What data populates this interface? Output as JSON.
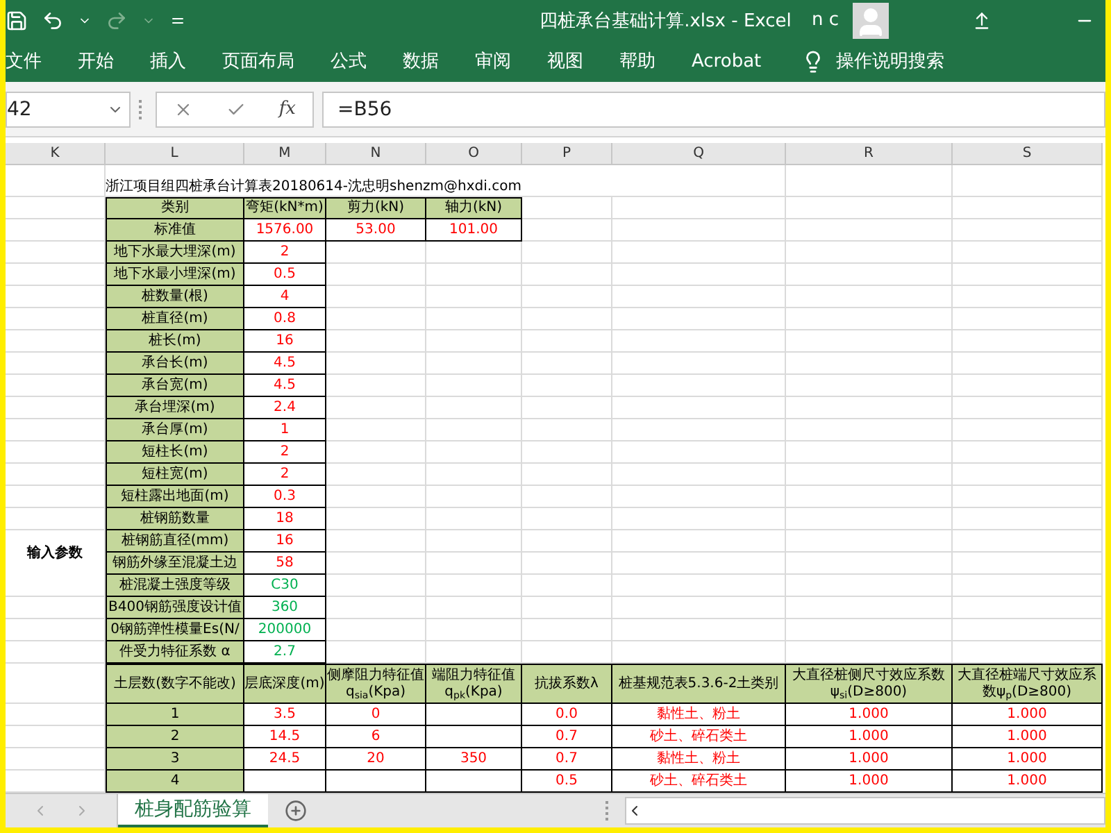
{
  "window": {
    "title": "四桩承台基础计算.xlsx  -  Excel",
    "user": "n c"
  },
  "ribbon_tabs": [
    "文件",
    "开始",
    "插入",
    "页面布局",
    "公式",
    "数据",
    "审阅",
    "视图",
    "帮助",
    "Acrobat"
  ],
  "tell_me": "操作说明搜索",
  "formula_bar": {
    "name_box": "42",
    "function_label": "fx",
    "formula": "=B56"
  },
  "columns": [
    "K",
    "L",
    "M",
    "N",
    "O",
    "P",
    "Q",
    "R",
    "S"
  ],
  "sheet": {
    "title_note": "浙江项目组四桩承台计算表20180614-沈忠明shenzm@hxdi.com",
    "section_label": "输入参数",
    "loads": {
      "headers": [
        "类别",
        "弯矩(kN*m)",
        "剪力(kN)",
        "轴力(kN)"
      ],
      "row_label": "标准值",
      "values": [
        "1576.00",
        "53.00",
        "101.00"
      ]
    },
    "params": [
      {
        "label": "地下水最大埋深(m)",
        "value": "2",
        "kind": "input"
      },
      {
        "label": "地下水最小埋深(m)",
        "value": "0.5",
        "kind": "input"
      },
      {
        "label": "桩数量(根)",
        "value": "4",
        "kind": "input"
      },
      {
        "label": "桩直径(m)",
        "value": "0.8",
        "kind": "input"
      },
      {
        "label": "桩长(m)",
        "value": "16",
        "kind": "input"
      },
      {
        "label": "承台长(m)",
        "value": "4.5",
        "kind": "input"
      },
      {
        "label": "承台宽(m)",
        "value": "4.5",
        "kind": "input"
      },
      {
        "label": "承台埋深(m)",
        "value": "2.4",
        "kind": "input"
      },
      {
        "label": "承台厚(m)",
        "value": "1",
        "kind": "input"
      },
      {
        "label": "短柱长(m)",
        "value": "2",
        "kind": "input"
      },
      {
        "label": "短柱宽(m)",
        "value": "2",
        "kind": "input"
      },
      {
        "label": "短柱露出地面(m)",
        "value": "0.3",
        "kind": "input"
      },
      {
        "label": "桩钢筋数量",
        "value": "18",
        "kind": "input"
      },
      {
        "label": "桩钢筋直径(mm)",
        "value": "16",
        "kind": "input"
      },
      {
        "label": "钢筋外缘至混凝土边",
        "value": "58",
        "kind": "input"
      },
      {
        "label": "桩混凝土强度等级",
        "value": "C30",
        "kind": "preset"
      },
      {
        "label": "B400钢筋强度设计值",
        "value": "360",
        "kind": "preset"
      },
      {
        "label": "0钢筋弹性模量Es(N/",
        "value": "200000",
        "kind": "preset"
      },
      {
        "label": "件受力特征系数 α",
        "value": "2.7",
        "kind": "preset"
      }
    ],
    "soil": {
      "headers": [
        "土层数(数字不能改)",
        "层底深度(m)",
        "侧摩阻力特征值q$_{sia}$(Kpa)",
        "端阻力特征值q$_{pk}$(Kpa)",
        "抗拔系数λ",
        "桩基规范表5.3.6-2土类别",
        "大直径桩侧尺寸效应系数ψ$_{si}$(D≥800)",
        "大直径桩端尺寸效应系数ψ$_{p}$(D≥800)"
      ],
      "rows": [
        [
          "1",
          "3.5",
          "0",
          "",
          "0.0",
          "黏性土、粉土",
          "1.000",
          "1.000"
        ],
        [
          "2",
          "14.5",
          "6",
          "",
          "0.7",
          "砂土、碎石类土",
          "1.000",
          "1.000"
        ],
        [
          "3",
          "24.5",
          "20",
          "350",
          "0.7",
          "黏性土、粉土",
          "1.000",
          "1.000"
        ],
        [
          "4",
          "",
          "",
          "",
          "0.5",
          "砂土、碎石类土",
          "1.000",
          "1.000"
        ]
      ]
    }
  },
  "sheet_tabs": [
    {
      "label": "桩身配筋验算",
      "selected": true
    }
  ]
}
